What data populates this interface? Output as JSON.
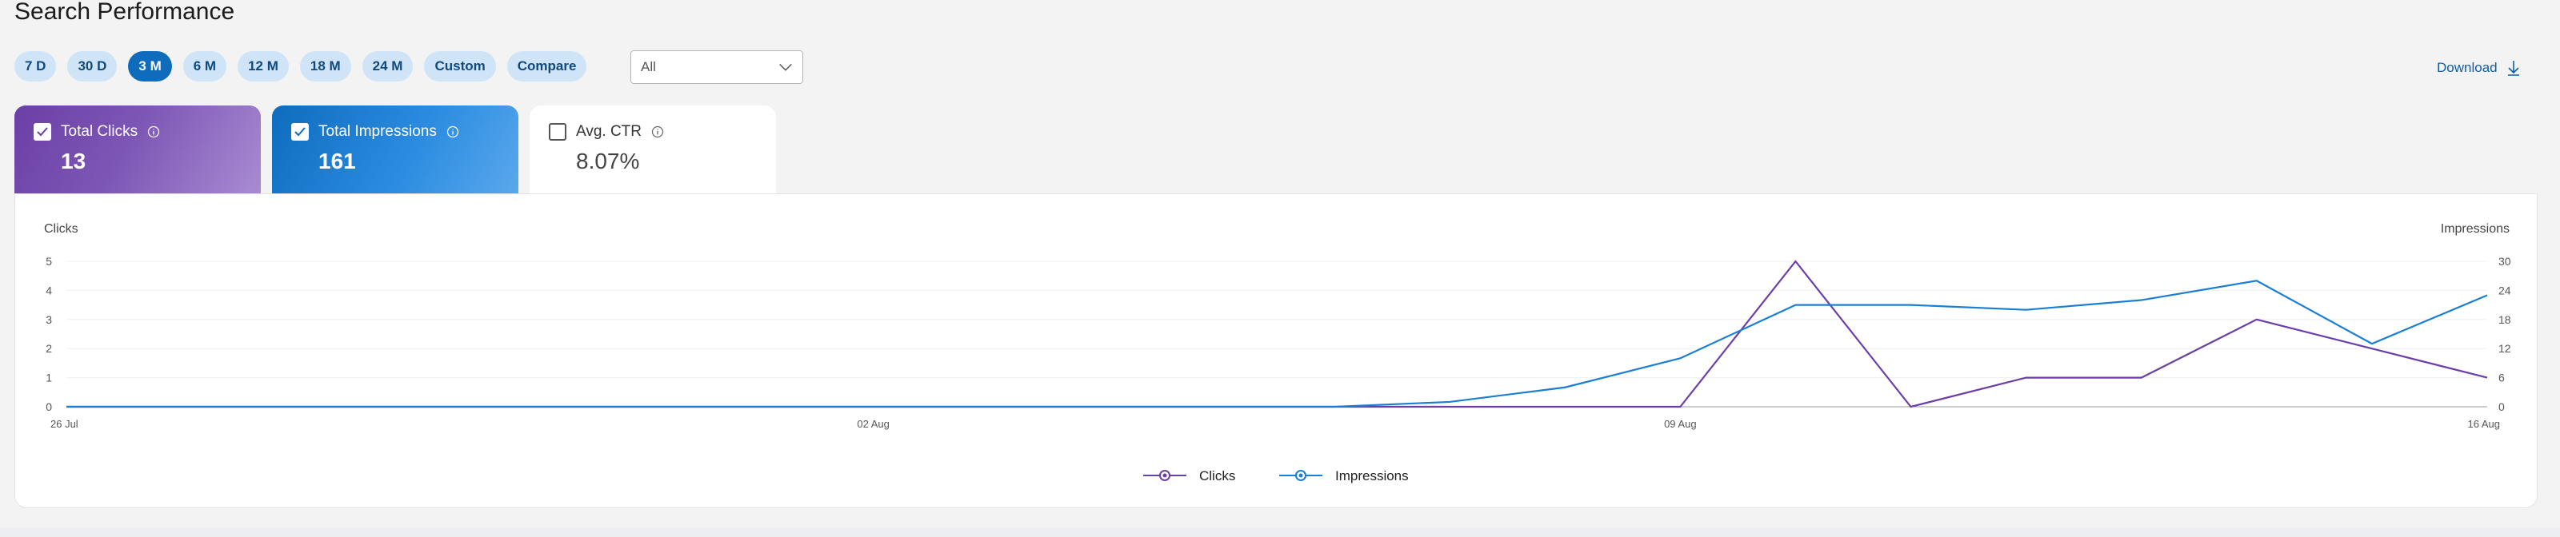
{
  "page": {
    "title": "Search Performance"
  },
  "ranges": [
    {
      "label": "7 D",
      "active": false
    },
    {
      "label": "30 D",
      "active": false
    },
    {
      "label": "3 M",
      "active": true
    },
    {
      "label": "6 M",
      "active": false
    },
    {
      "label": "12 M",
      "active": false
    },
    {
      "label": "18 M",
      "active": false
    },
    {
      "label": "24 M",
      "active": false
    },
    {
      "label": "Custom",
      "active": false
    },
    {
      "label": "Compare",
      "active": false
    }
  ],
  "filter": {
    "selected": "All"
  },
  "download": {
    "label": "Download"
  },
  "metrics": [
    {
      "label": "Total Clicks",
      "value": "13",
      "checked": true
    },
    {
      "label": "Total Impressions",
      "value": "161",
      "checked": true
    },
    {
      "label": "Avg. CTR",
      "value": "8.07%",
      "checked": false
    }
  ],
  "colors": {
    "clicks": "#6b3fa6",
    "impressions": "#1a7fd4",
    "active_pill": "#0f6cbd",
    "pill": "#cfe4f7"
  },
  "icons": {
    "info": "info-icon",
    "checkbox": "checkbox-icon",
    "download": "download-icon",
    "dropdown": "chevron-down-icon"
  },
  "chart_data": {
    "type": "line",
    "ylabel_left": "Clicks",
    "ylabel_right": "Impressions",
    "x": [
      "26 Jul",
      "27 Jul",
      "28 Jul",
      "29 Jul",
      "30 Jul",
      "31 Jul",
      "01 Aug",
      "02 Aug",
      "03 Aug",
      "04 Aug",
      "05 Aug",
      "06 Aug",
      "07 Aug",
      "08 Aug",
      "09 Aug",
      "10 Aug",
      "11 Aug",
      "12 Aug",
      "13 Aug",
      "14 Aug",
      "15 Aug",
      "16 Aug"
    ],
    "x_ticks": [
      "26 Jul",
      "02 Aug",
      "09 Aug",
      "16 Aug"
    ],
    "y_left_ticks": [
      0,
      1,
      2,
      3,
      4,
      5
    ],
    "y_right_ticks": [
      0,
      6,
      12,
      18,
      24,
      30
    ],
    "ylim_left": [
      0,
      5
    ],
    "ylim_right": [
      0,
      30
    ],
    "grid": true,
    "legend": "bottom-center",
    "series": [
      {
        "name": "Clicks",
        "axis": "left",
        "values": [
          0,
          0,
          0,
          0,
          0,
          0,
          0,
          0,
          0,
          0,
          0,
          0,
          0,
          0,
          0,
          5,
          0,
          1,
          1,
          3,
          2,
          1
        ]
      },
      {
        "name": "Impressions",
        "axis": "right",
        "values": [
          0,
          0,
          0,
          0,
          0,
          0,
          0,
          0,
          0,
          0,
          0,
          0,
          1,
          4,
          10,
          21,
          21,
          20,
          22,
          26,
          13,
          23
        ]
      }
    ]
  }
}
